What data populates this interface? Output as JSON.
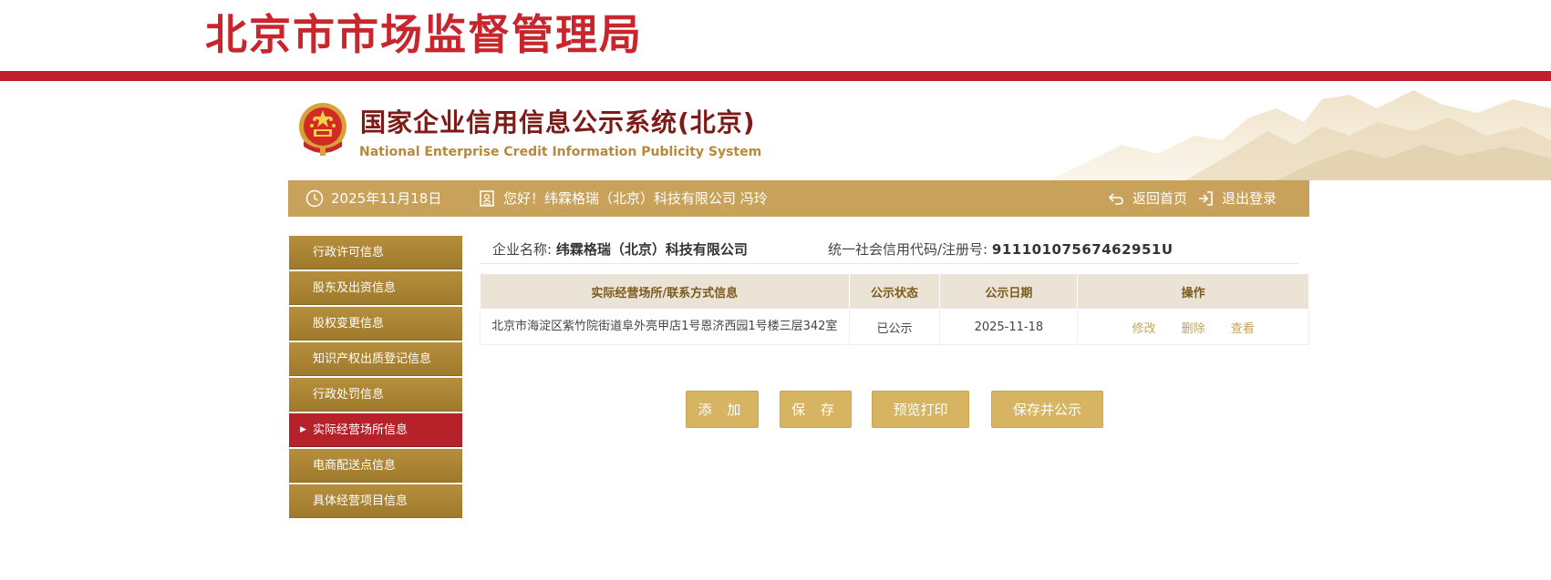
{
  "header": {
    "bureau_title": "北京市市场监督管理局",
    "system_title_cn": "国家企业信用信息公示系统(北京)",
    "system_title_en": "National Enterprise Credit Information Publicity System"
  },
  "info_bar": {
    "date": "2025年11月18日",
    "greeting": "您好！纬霖格瑞（北京）科技有限公司 冯玲",
    "home_label": "返回首页",
    "logout_label": "退出登录"
  },
  "sidebar": {
    "items": [
      {
        "label": "行政许可信息",
        "active": false
      },
      {
        "label": "股东及出资信息",
        "active": false
      },
      {
        "label": "股权变更信息",
        "active": false
      },
      {
        "label": "知识产权出质登记信息",
        "active": false
      },
      {
        "label": "行政处罚信息",
        "active": false
      },
      {
        "label": "实际经营场所信息",
        "active": true
      },
      {
        "label": "电商配送点信息",
        "active": false
      },
      {
        "label": "具体经营项目信息",
        "active": false
      }
    ]
  },
  "company": {
    "name_label": "企业名称:",
    "name_value": "纬霖格瑞（北京）科技有限公司",
    "credit_label": "统一社会信用代码/注册号:",
    "credit_value": "91110107567462951U"
  },
  "table": {
    "headers": [
      "实际经营场所/联系方式信息",
      "公示状态",
      "公示日期",
      "操作"
    ],
    "rows": [
      {
        "address": "北京市海淀区紫竹院街道阜外亮甲店1号恩济西园1号楼三层342室",
        "status": "已公示",
        "date": "2025-11-18",
        "ops": [
          "修改",
          "删除",
          "查看"
        ]
      }
    ]
  },
  "buttons": {
    "add": "添 加",
    "save": "保 存",
    "preview": "预览打印",
    "save_publish": "保存并公示"
  },
  "colors": {
    "brand_red": "#c01f30",
    "gold": "#c8a25a",
    "sidebar_gold": "#a8822f",
    "active_red": "#b7222a",
    "link_gold": "#c7a258"
  }
}
